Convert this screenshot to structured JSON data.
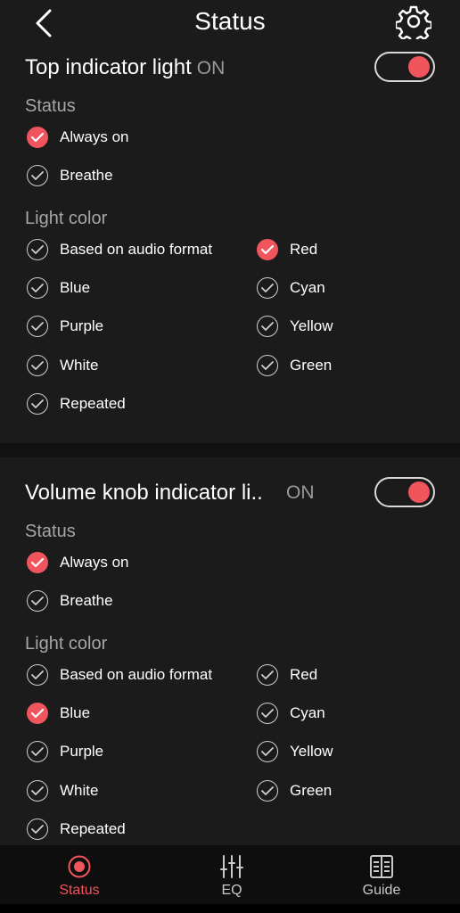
{
  "header": {
    "title": "Status"
  },
  "sections": [
    {
      "title": "Top indicator light",
      "state": "ON",
      "toggle_on": true,
      "status_label": "Status",
      "status_options": [
        {
          "label": "Always on",
          "selected": true
        },
        {
          "label": "Breathe",
          "selected": false
        }
      ],
      "color_label": "Light color",
      "colors": [
        {
          "label": "Based on audio format",
          "selected": false
        },
        {
          "label": "Red",
          "selected": true
        },
        {
          "label": "Blue",
          "selected": false
        },
        {
          "label": "Cyan",
          "selected": false
        },
        {
          "label": "Purple",
          "selected": false
        },
        {
          "label": "Yellow",
          "selected": false
        },
        {
          "label": "White",
          "selected": false
        },
        {
          "label": "Green",
          "selected": false
        },
        {
          "label": "Repeated",
          "selected": false
        }
      ]
    },
    {
      "title": "Volume knob indicator li..",
      "state": "ON",
      "toggle_on": true,
      "status_label": "Status",
      "status_options": [
        {
          "label": "Always on",
          "selected": true
        },
        {
          "label": "Breathe",
          "selected": false
        }
      ],
      "color_label": "Light color",
      "colors": [
        {
          "label": "Based on audio format",
          "selected": false
        },
        {
          "label": "Red",
          "selected": false
        },
        {
          "label": "Blue",
          "selected": true
        },
        {
          "label": "Cyan",
          "selected": false
        },
        {
          "label": "Purple",
          "selected": false
        },
        {
          "label": "Yellow",
          "selected": false
        },
        {
          "label": "White",
          "selected": false
        },
        {
          "label": "Green",
          "selected": false
        },
        {
          "label": "Repeated",
          "selected": false
        }
      ]
    }
  ],
  "tabs": [
    {
      "label": "Status",
      "icon": "status-icon",
      "active": true
    },
    {
      "label": "EQ",
      "icon": "eq-icon",
      "active": false
    },
    {
      "label": "Guide",
      "icon": "guide-icon",
      "active": false
    }
  ],
  "colors": {
    "accent": "#f0545c",
    "background": "#1b1b1b"
  }
}
